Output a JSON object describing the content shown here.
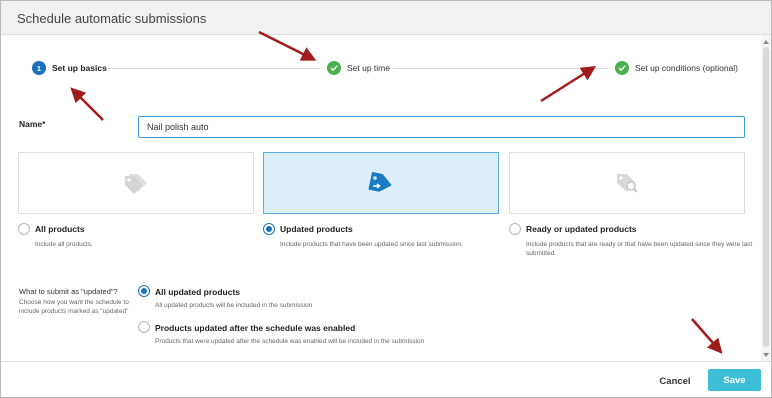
{
  "dialog": {
    "title": "Schedule automatic submissions"
  },
  "stepper": {
    "steps": [
      {
        "number": "1",
        "label": "Set up basics",
        "state": "current"
      },
      {
        "number": "",
        "label": "Set up time",
        "state": "done"
      },
      {
        "number": "",
        "label": "Set up conditions (optional)",
        "state": "done"
      }
    ]
  },
  "name_field": {
    "label": "Name*",
    "value": "Nail polish auto"
  },
  "product_options": [
    {
      "label": "All products",
      "description": "Include all products.",
      "selected": false,
      "icon": "tags-icon"
    },
    {
      "label": "Updated products",
      "description": "Include products that have been updated since last submission.",
      "selected": true,
      "icon": "tag-arrow-icon"
    },
    {
      "label": "Ready or updated products",
      "description": "Include products that are ready or that have been updated since they were last submitted.",
      "selected": false,
      "icon": "tag-search-icon"
    }
  ],
  "updated_section": {
    "title": "What to submit as \"updated\"?",
    "help": "Choose how you want the schedule to include products marked as \"updated\"",
    "options": [
      {
        "label": "All updated products",
        "description": "All updated products will be included in the submission",
        "selected": true
      },
      {
        "label": "Products updated after the schedule was enabled",
        "description": "Products that were updated after the schedule was enabled will be included in the submission",
        "selected": false
      }
    ]
  },
  "footer": {
    "cancel_label": "Cancel",
    "save_label": "Save"
  },
  "colors": {
    "primary": "#1a73b8",
    "success": "#4caf50",
    "save": "#3cbfd6",
    "selected_card": "#dbeef9",
    "annotation_arrow": "#a01c1c"
  }
}
